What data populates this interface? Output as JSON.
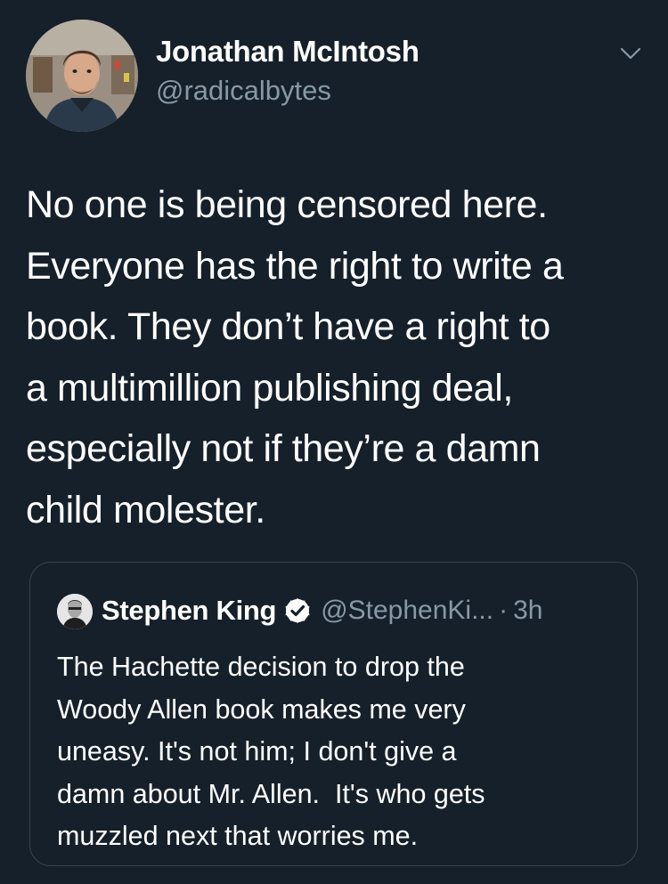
{
  "tweet": {
    "author": {
      "display_name": "Jonathan McIntosh",
      "handle": "@radicalbytes",
      "avatar_icon": "profile-photo"
    },
    "text_lines": [
      "No one is being censored here.",
      "Everyone has the right to write a",
      "book. They don’t have a right to",
      "a multimillion publishing deal,",
      "especially not if they’re a damn",
      "child molester."
    ],
    "menu_icon": "chevron-down-icon"
  },
  "quoted_tweet": {
    "author": {
      "display_name": "Stephen King",
      "handle": "@StephenKi...",
      "verified": true,
      "avatar_icon": "profile-photo"
    },
    "separator": "·",
    "time": "3h",
    "text_lines": [
      "The Hachette decision to drop the",
      "Woody Allen book makes me very",
      "uneasy. It's not him; I don't give a",
      "damn about Mr. Allen.  It's who gets",
      "muzzled next that worries me."
    ]
  },
  "colors": {
    "background": "#15202b",
    "primary_text": "#ffffff",
    "secondary_text": "#8899a6",
    "border": "#38444d"
  }
}
